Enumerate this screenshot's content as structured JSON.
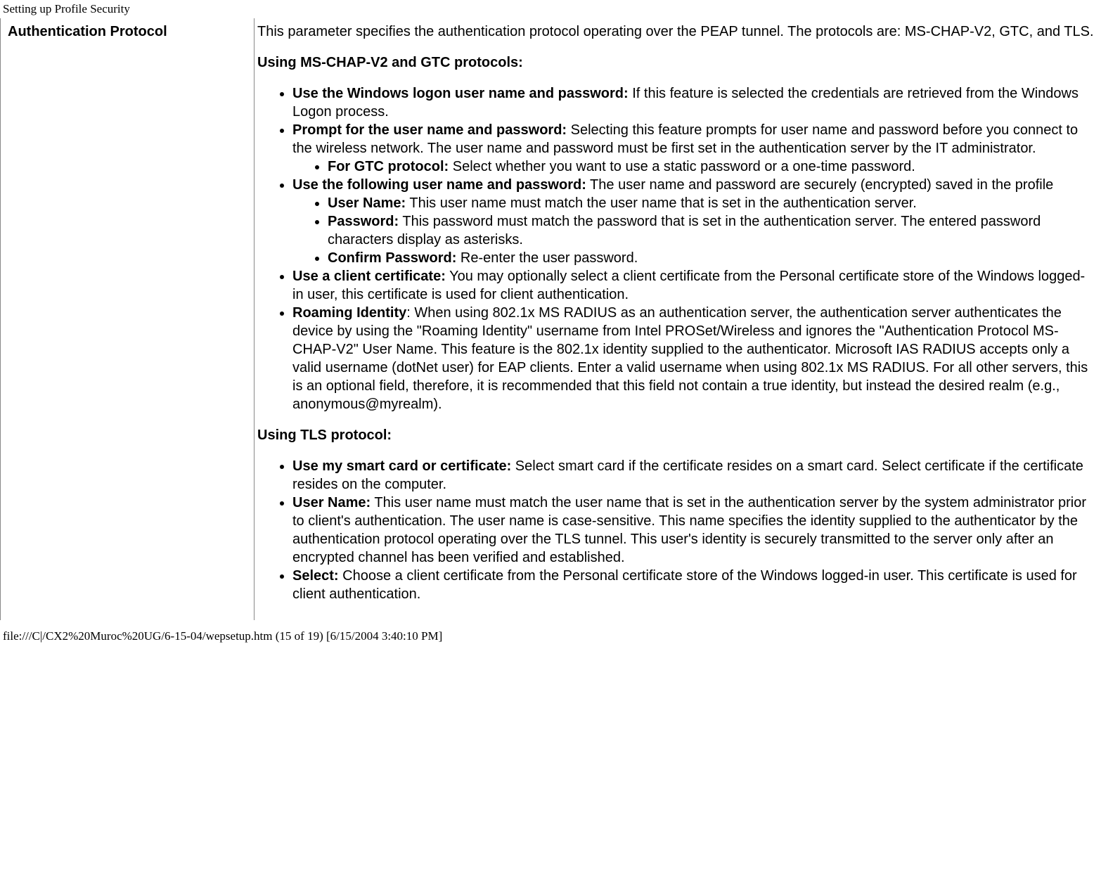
{
  "header": {
    "title": "Setting up Profile Security"
  },
  "left": {
    "title": "Authentication Protocol"
  },
  "intro": "This parameter specifies the authentication protocol operating over the PEAP tunnel. The protocols are: MS-CHAP-V2, GTC, and TLS.",
  "section1_heading": "Using MS-CHAP-V2 and GTC protocols:",
  "items1": {
    "i0_b": "Use the Windows logon user name and password:",
    "i0_t": " If this feature is selected the credentials are retrieved from the Windows Logon process.",
    "i1_b": "Prompt for the user name and password:",
    "i1_t": " Selecting this feature prompts for user name and password before you connect to the wireless network. The user name and password must be first set in the authentication server by the IT administrator.",
    "i1_sub0_b": "For GTC protocol:",
    "i1_sub0_t": " Select whether you want to use a static password or a one-time password.",
    "i2_b": "Use the following user name and password:",
    "i2_t": " The user name and password are securely (encrypted) saved in the profile",
    "i2_sub0_b": "User Name:",
    "i2_sub0_t": " This user name must match the user name that is set in the authentication server.",
    "i2_sub1_b": "Password:",
    "i2_sub1_t": " This password must match the password that is set in the authentication server. The entered password characters display as asterisks.",
    "i2_sub2_b": "Confirm Password:",
    "i2_sub2_t": " Re-enter the user password.",
    "i3_b": "Use a client certificate:",
    "i3_t": " You may optionally select a client certificate from the Personal certificate store of the Windows logged-in user, this certificate is used for client authentication.",
    "i4_b": "Roaming Identity",
    "i4_t": ": When using 802.1x MS RADIUS as an authentication server, the authentication server authenticates the device by using the \"Roaming Identity\" username from Intel PROSet/Wireless and ignores the \"Authentication Protocol MS-CHAP-V2\" User Name. This feature is the 802.1x identity supplied to the authenticator. Microsoft IAS RADIUS accepts only a valid username (dotNet user) for EAP clients. Enter a valid username when using 802.1x MS RADIUS. For all other servers, this is an optional field, therefore, it is recommended that this field not contain a true identity, but instead the desired realm (e.g., anonymous@myrealm)."
  },
  "section2_heading": "Using TLS protocol:",
  "items2": {
    "i0_b": "Use my smart card or certificate:",
    "i0_t": " Select smart card if the certificate resides on a smart card. Select certificate if the certificate resides on the computer.",
    "i1_b": "User Name:",
    "i1_t": " This user name must match the user name that is set in the authentication server by the system administrator prior to client's authentication. The user name is case-sensitive. This name specifies the identity supplied to the authenticator by the authentication protocol operating over the TLS tunnel. This user's identity is securely transmitted to the server only after an encrypted channel has been verified and established.",
    "i2_b": "Select:",
    "i2_t": " Choose a client certificate from the Personal certificate store of the Windows logged-in user. This certificate is used for client authentication."
  },
  "footer": {
    "text": "file:///C|/CX2%20Muroc%20UG/6-15-04/wepsetup.htm (15 of 19) [6/15/2004 3:40:10 PM]"
  }
}
